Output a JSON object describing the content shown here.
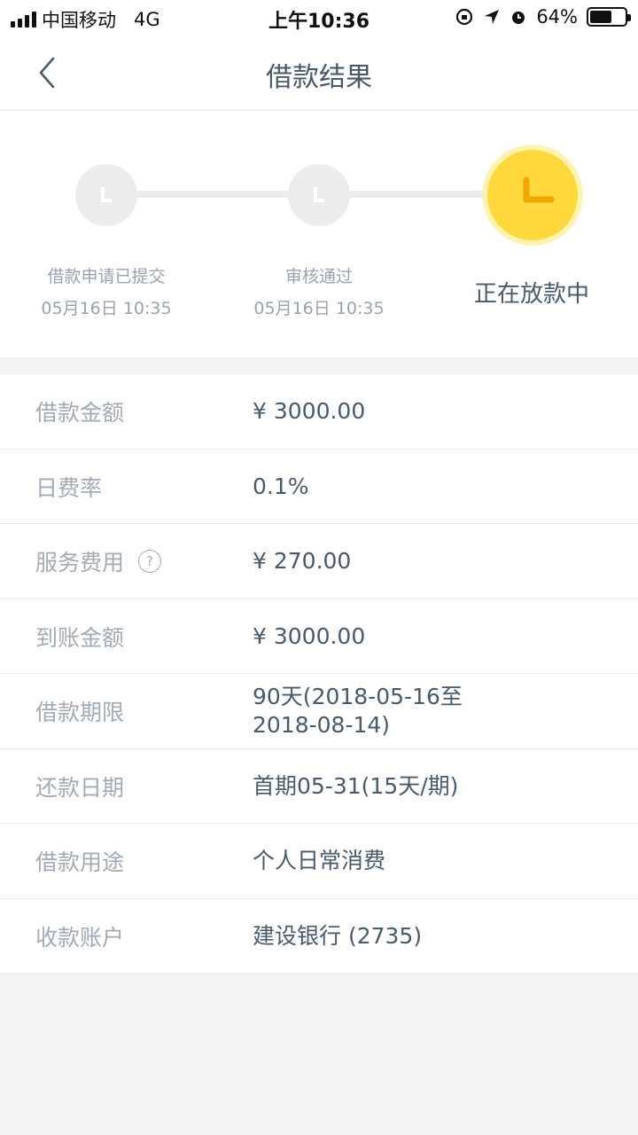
{
  "status_bar": {
    "carrier": "中国移动",
    "network": "4G",
    "time": "上午10:36",
    "battery": "64%",
    "battery_level": 0.64
  },
  "nav": {
    "title": "借款结果"
  },
  "progress": {
    "steps": [
      {
        "label": "借款申请已提交",
        "date": "05月16日 10:35"
      },
      {
        "label": "审核通过",
        "date": "05月16日 10:35"
      },
      {
        "label": "正在放款中"
      }
    ]
  },
  "details": [
    {
      "label": "借款金额",
      "value": "¥ 3000.00"
    },
    {
      "label": "日费率",
      "value": "0.1%"
    },
    {
      "label": "服务费用",
      "value": "¥ 270.00",
      "help": "?"
    },
    {
      "label": "到账金额",
      "value": "¥ 3000.00"
    },
    {
      "label": "借款期限",
      "value": "90天(2018-05-16至 2018-08-14)"
    },
    {
      "label": "还款日期",
      "value": "首期05-31(15天/期)"
    },
    {
      "label": "借款用途",
      "value": "个人日常消费"
    },
    {
      "label": "收款账户",
      "value": "建设银行 (2735)"
    }
  ],
  "colors": {
    "accent_yellow": "#ffd93b",
    "accent_orange": "#f5a500",
    "text_primary": "#4a5a6a",
    "text_secondary": "#a3abb4"
  }
}
